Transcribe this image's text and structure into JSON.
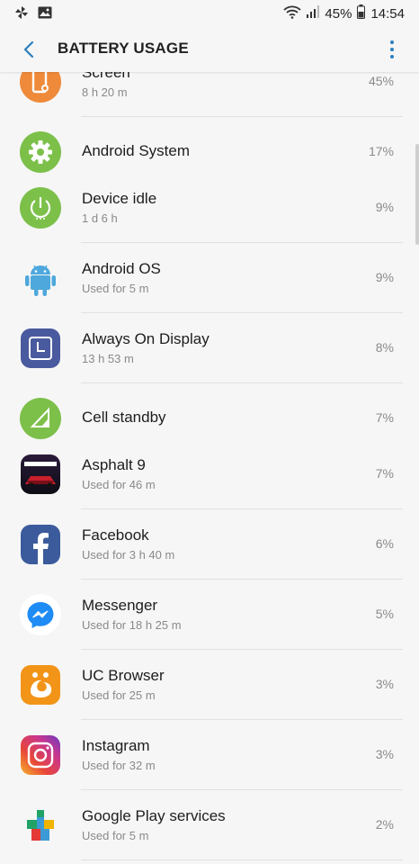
{
  "status_bar": {
    "battery_percent": "45%",
    "time": "14:54",
    "icons": [
      "pinwheel-icon",
      "image-icon",
      "wifi-icon",
      "signal-icon",
      "battery-icon"
    ]
  },
  "app_bar": {
    "title": "BATTERY USAGE",
    "back_icon": "back-arrow-icon",
    "more_icon": "more-vert-icon",
    "accent": "#2b7fbd"
  },
  "items": [
    {
      "name": "Screen",
      "sub": "8 h 20 m",
      "pct": "45%",
      "icon": "screen-brightness-icon",
      "color": "#ee8a3a"
    },
    {
      "name": "Android System",
      "sub": "",
      "pct": "17%",
      "icon": "gear-icon",
      "color": "#7cc04a"
    },
    {
      "name": "Device idle",
      "sub": "1 d 6 h",
      "pct": "9%",
      "icon": "power-icon",
      "color": "#7cc04a"
    },
    {
      "name": "Android OS",
      "sub": "Used for 5 m",
      "pct": "9%",
      "icon": "android-robot-icon",
      "color": "#4ea8dc"
    },
    {
      "name": "Always On Display",
      "sub": "13 h 53 m",
      "pct": "8%",
      "icon": "clock-display-icon",
      "color": "#4a5a9e"
    },
    {
      "name": "Cell standby",
      "sub": "",
      "pct": "7%",
      "icon": "signal-triangle-icon",
      "color": "#7cc04a"
    },
    {
      "name": "Asphalt 9",
      "sub": "Used for 46 m",
      "pct": "7%",
      "icon": "asphalt-9-icon",
      "color": "#c8202c"
    },
    {
      "name": "Facebook",
      "sub": "Used for 3 h 40 m",
      "pct": "6%",
      "icon": "facebook-icon",
      "color": "#3b5b9c"
    },
    {
      "name": "Messenger",
      "sub": "Used for 18 h 25 m",
      "pct": "5%",
      "icon": "messenger-icon",
      "color": "#1f8cf5"
    },
    {
      "name": "UC Browser",
      "sub": "Used for 25 m",
      "pct": "3%",
      "icon": "uc-browser-icon",
      "color": "#f29418"
    },
    {
      "name": "Instagram",
      "sub": "Used for 32 m",
      "pct": "3%",
      "icon": "instagram-icon",
      "color": "#c8368f"
    },
    {
      "name": "Google Play services",
      "sub": "Used for 5 m",
      "pct": "2%",
      "icon": "google-play-services-icon",
      "color": "#3c9ad6"
    }
  ]
}
